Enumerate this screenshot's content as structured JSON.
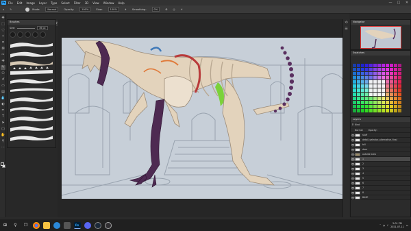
{
  "menubar": {
    "logo": "Ps",
    "items": [
      "File",
      "Edit",
      "Image",
      "Layer",
      "Type",
      "Select",
      "Filter",
      "3D",
      "View",
      "Window",
      "Help"
    ],
    "window_controls": [
      "—",
      "□",
      "✕"
    ]
  },
  "options_bar": {
    "mode_label": "Mode:",
    "mode_value": "Normal",
    "opacity_label": "Opacity:",
    "opacity_value": "100%",
    "flow_label": "Flow:",
    "flow_value": "100%",
    "smoothing_label": "Smoothing:",
    "smoothing_value": "0%"
  },
  "document": {
    "tab_title": "LOCATION MUSEUM JUMBO.psd @ 16.7% (1 - RGB/8)",
    "close": "×"
  },
  "brushes_panel": {
    "title": "Brushes",
    "size_label": "Size:",
    "size_value": "36 px"
  },
  "navigator": {
    "title": "Navigator"
  },
  "swatches": {
    "title": "Swatches"
  },
  "layers_panel": {
    "title": "Layers",
    "kind_label": "Kind",
    "blend_mode": "Normal",
    "opacity_label": "Opacity:",
    "fill_label": "Fill:",
    "layers": [
      {
        "name": "stuff",
        "selected": false,
        "group": false
      },
      {
        "name": "detail_selector_alternative_final",
        "selected": false,
        "group": false
      },
      {
        "name": "bill",
        "selected": false,
        "group": false
      },
      {
        "name": "door",
        "selected": false,
        "group": false
      },
      {
        "name": "outside area",
        "selected": false,
        "group": true
      },
      {
        "name": "1",
        "selected": true,
        "group": false
      },
      {
        "name": "2",
        "selected": false,
        "group": false
      },
      {
        "name": "3",
        "selected": false,
        "group": false
      },
      {
        "name": "4",
        "selected": false,
        "group": false
      },
      {
        "name": "5",
        "selected": false,
        "group": false
      },
      {
        "name": "6",
        "selected": false,
        "group": false
      },
      {
        "name": "7",
        "selected": false,
        "group": false
      },
      {
        "name": "8",
        "selected": false,
        "group": false
      },
      {
        "name": "BASE",
        "selected": false,
        "group": false
      }
    ]
  },
  "status_bar": {
    "zoom": "16.67%",
    "doc_info": "Doc: 98.5M/2.25G"
  },
  "taskbar": {
    "start_icon": "windows-start-icon",
    "apps": [
      "search-icon",
      "task-view-icon",
      "chrome-icon",
      "file-explorer-icon",
      "edge-icon",
      "store-icon",
      "photoshop-icon",
      "discord-icon",
      "steam-icon",
      "obs-icon"
    ],
    "time": "2:01 PM",
    "date": "2021-07-11"
  },
  "colors": {
    "canvas_bg": "#c7cfd8",
    "accent_blue": "#31a8ff",
    "skeleton_purple": "#4e2a52",
    "skeleton_bone": "#e3d3bc",
    "highlight_green": "#7bd23a",
    "highlight_orange": "#e07a3a",
    "highlight_red": "#b83a3a"
  }
}
